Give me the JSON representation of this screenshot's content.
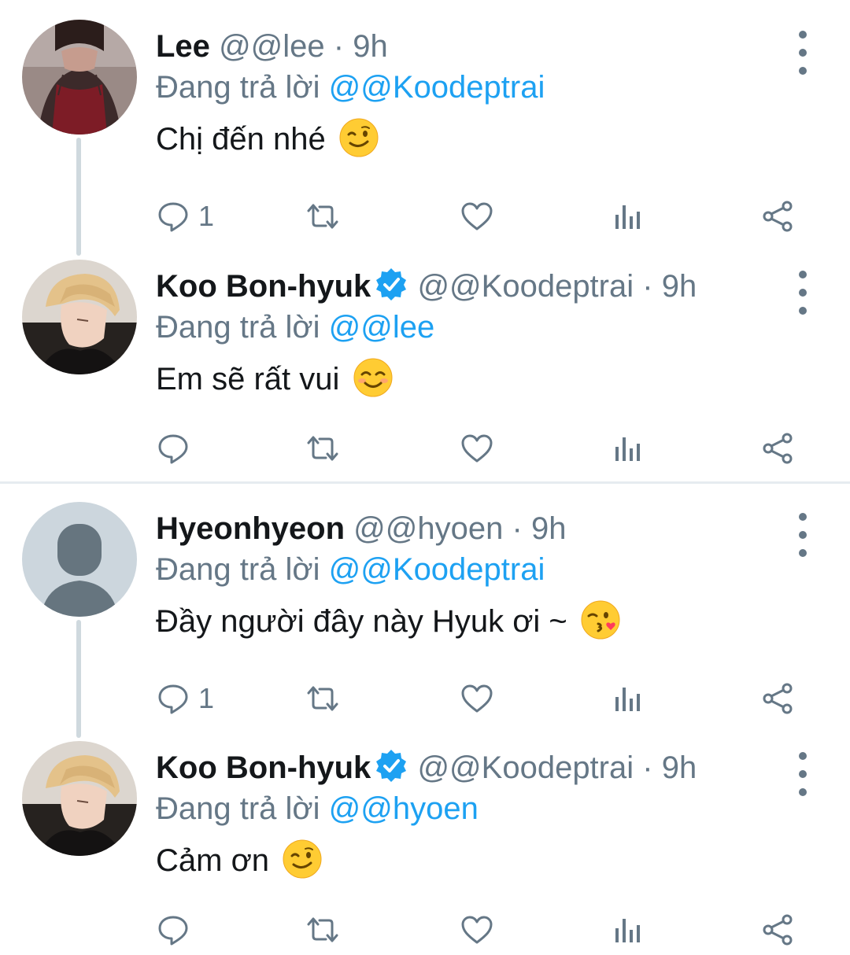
{
  "colors": {
    "link": "#1da1f2",
    "secondary": "#657786",
    "verified": "#1da1f2",
    "divider": "#e6ecf0"
  },
  "threads": [
    {
      "tweets": [
        {
          "name": "Lee",
          "verified": false,
          "handle": "@@lee",
          "separator": "·",
          "time": "9h",
          "reply_prefix": "Đang trả lời",
          "reply_to": "@@Koodeptrai",
          "text": "Chị đến nhé",
          "emoji": "winking-face",
          "reply_count": "1",
          "avatar": "photo-lee"
        },
        {
          "name": "Koo Bon-hyuk",
          "verified": true,
          "handle": "@@Koodeptrai",
          "separator": "·",
          "time": "9h",
          "reply_prefix": "Đang trả lời",
          "reply_to": "@@lee",
          "text": "Em sẽ rất vui",
          "emoji": "smiling-face-with-smiling-eyes",
          "reply_count": "",
          "avatar": "photo-koo"
        }
      ]
    },
    {
      "tweets": [
        {
          "name": "Hyeonhyeon",
          "verified": false,
          "handle": "@@hyoen",
          "separator": "·",
          "time": "9h",
          "reply_prefix": "Đang trả lời",
          "reply_to": "@@Koodeptrai",
          "text": "Đầy người đây này Hyuk ơi ~",
          "emoji": "face-blowing-a-kiss",
          "reply_count": "1",
          "avatar": "default-avatar"
        },
        {
          "name": "Koo Bon-hyuk",
          "verified": true,
          "handle": "@@Koodeptrai",
          "separator": "·",
          "time": "9h",
          "reply_prefix": "Đang trả lời",
          "reply_to": "@@hyoen",
          "text": "Cảm ơn",
          "emoji": "winking-face",
          "reply_count": "",
          "avatar": "photo-koo"
        }
      ]
    }
  ]
}
